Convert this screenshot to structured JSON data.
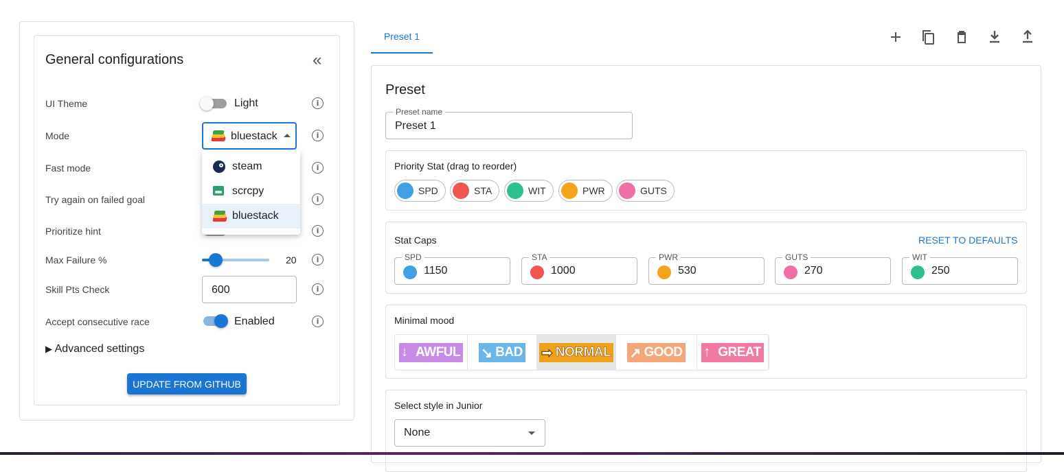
{
  "general": {
    "title": "General configurations",
    "collapse_glyph": "«",
    "ui_theme": {
      "label": "UI Theme",
      "value": "Light",
      "enabled": false
    },
    "mode": {
      "label": "Mode",
      "value": "bluestack",
      "options": [
        "steam",
        "scrcpy",
        "bluestack"
      ],
      "selected": "bluestack"
    },
    "fast_mode": {
      "label": "Fast mode"
    },
    "try_again": {
      "label": "Try again on failed goal"
    },
    "prioritize_hint": {
      "label": "Prioritize hint"
    },
    "max_failure": {
      "label": "Max Failure %",
      "value": "20",
      "fraction": 0.2
    },
    "skill_pts": {
      "label": "Skill Pts Check",
      "value": "600"
    },
    "accept_race": {
      "label": "Accept consecutive race",
      "value": "Enabled",
      "enabled": true
    },
    "advanced": {
      "glyph": "▶",
      "label": "Advanced settings"
    },
    "update_button": "UPDATE FROM GITHUB",
    "info_glyph": "i"
  },
  "tabs": [
    {
      "label": "Preset 1",
      "active": true
    }
  ],
  "toolbar": {
    "icons": [
      "add-icon",
      "copy-icon",
      "delete-icon",
      "download-icon",
      "upload-icon"
    ]
  },
  "preset": {
    "title": "Preset",
    "name_label": "Preset name",
    "name_value": "Preset 1",
    "priority": {
      "label": "Priority Stat (drag to reorder)",
      "stats": [
        {
          "name": "SPD",
          "color": "#3fa0e6"
        },
        {
          "name": "STA",
          "color": "#f0554f"
        },
        {
          "name": "WIT",
          "color": "#2fbf8f"
        },
        {
          "name": "PWR",
          "color": "#f5a21d"
        },
        {
          "name": "GUTS",
          "color": "#f06fa6"
        }
      ]
    },
    "caps": {
      "label": "Stat Caps",
      "reset": "RESET TO DEFAULTS",
      "items": [
        {
          "name": "SPD",
          "value": "1150",
          "color": "#3fa0e6"
        },
        {
          "name": "STA",
          "value": "1000",
          "color": "#f0554f"
        },
        {
          "name": "PWR",
          "value": "530",
          "color": "#f5a21d"
        },
        {
          "name": "GUTS",
          "value": "270",
          "color": "#f06fa6"
        },
        {
          "name": "WIT",
          "value": "250",
          "color": "#2fbf8f"
        }
      ]
    },
    "mood": {
      "label": "Minimal mood",
      "options": [
        {
          "text": "AWFUL",
          "color": "#c98ae6",
          "arrow": "↓"
        },
        {
          "text": "BAD",
          "color": "#68b6ea",
          "arrow": "↘"
        },
        {
          "text": "NORMAL",
          "color": "#f0a11a",
          "arrow": "➡"
        },
        {
          "text": "GOOD",
          "color": "#f6a77a",
          "arrow": "↗"
        },
        {
          "text": "GREAT",
          "color": "#f27aa2",
          "arrow": "↑"
        }
      ],
      "selected": "NORMAL"
    },
    "junior": {
      "label": "Select style in Junior",
      "value": "None"
    }
  },
  "colors": {
    "accent": "#1976d2",
    "switch_on": "#1976d2"
  }
}
